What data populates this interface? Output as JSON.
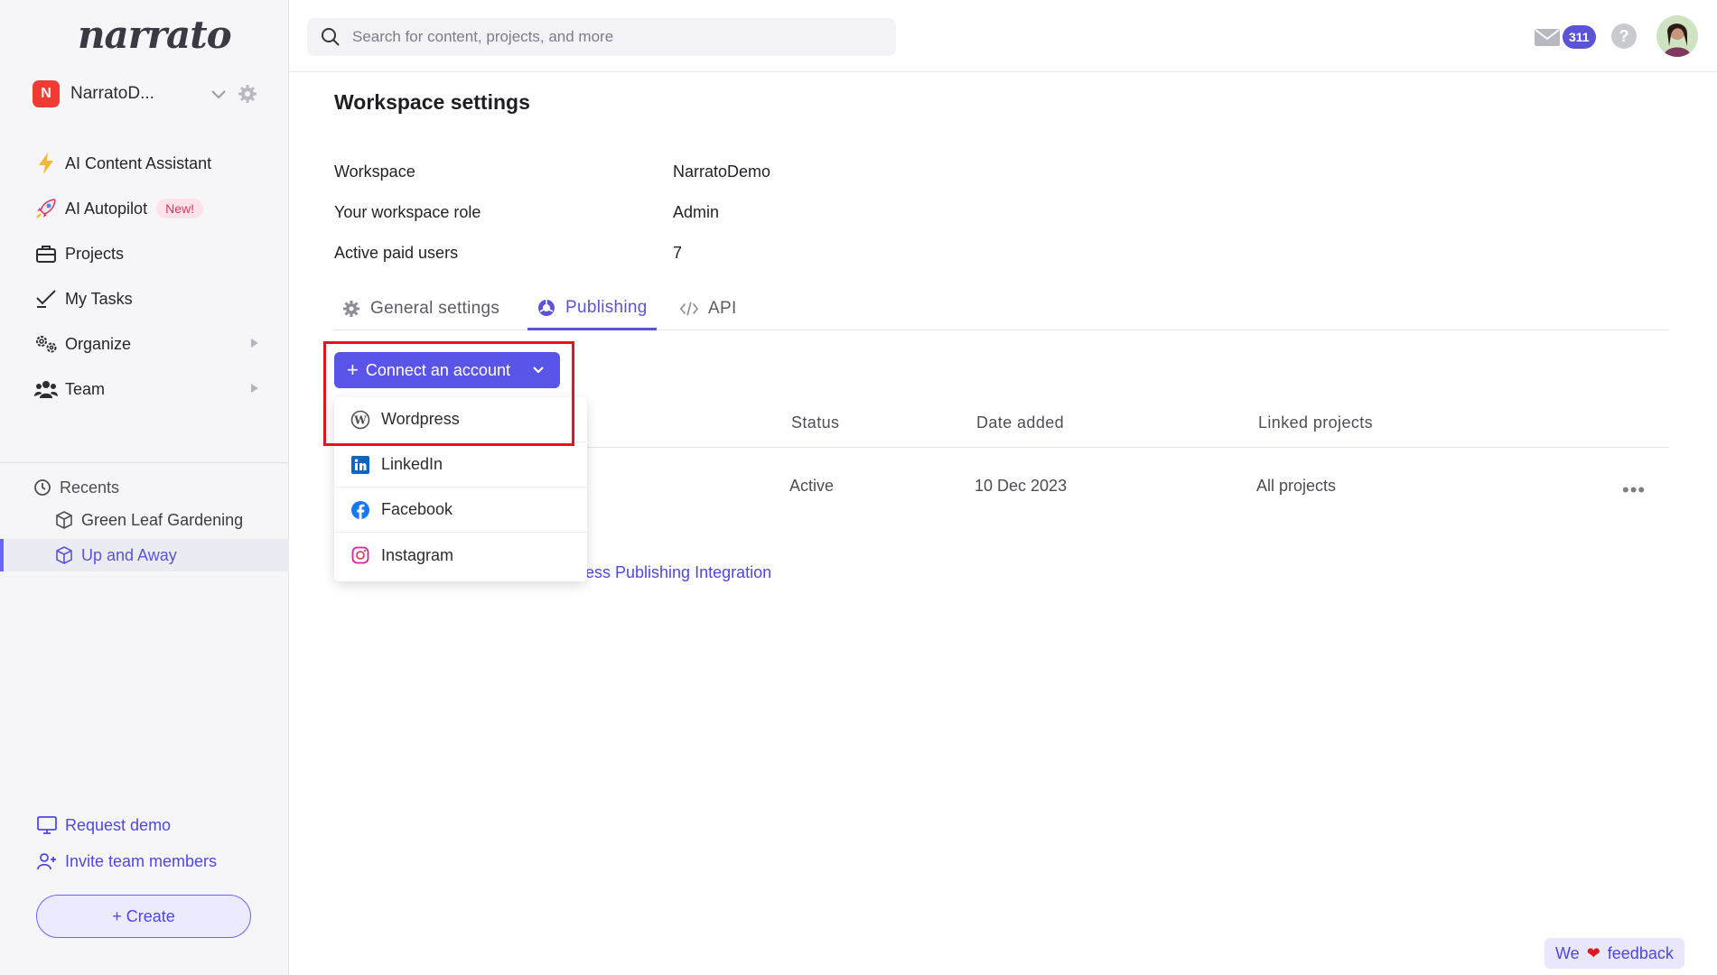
{
  "app": {
    "logo_text": "narrato"
  },
  "workspace_switcher": {
    "avatar_letter": "N",
    "name": "NarratoD..."
  },
  "sidebar": {
    "items": [
      {
        "label": "AI Content Assistant",
        "icon": "lightning-icon"
      },
      {
        "label": "AI Autopilot",
        "icon": "rocket-icon",
        "badge": "New!"
      },
      {
        "label": "Projects",
        "icon": "briefcase-icon"
      },
      {
        "label": "My Tasks",
        "icon": "checkmark-icon"
      },
      {
        "label": "Organize",
        "icon": "gears-icon",
        "has_submenu": true
      },
      {
        "label": "Team",
        "icon": "team-icon",
        "has_submenu": true
      }
    ],
    "recents_label": "Recents",
    "recents": [
      {
        "label": "Green Leaf Gardening",
        "active": false
      },
      {
        "label": "Up and Away",
        "active": true
      }
    ],
    "request_demo": "Request demo",
    "invite": "Invite team members",
    "create": "+ Create"
  },
  "search": {
    "placeholder": "Search for content, projects, and more"
  },
  "topbar": {
    "mail_count": "311",
    "help_label": "?"
  },
  "page": {
    "title": "Workspace settings",
    "info": [
      {
        "key": "Workspace",
        "value": "NarratoDemo"
      },
      {
        "key": "Your workspace role",
        "value": "Admin"
      },
      {
        "key": "Active paid users",
        "value": "7"
      }
    ],
    "tabs": [
      {
        "label": "General settings",
        "active": false
      },
      {
        "label": "Publishing",
        "active": true
      },
      {
        "label": "API",
        "active": false
      }
    ],
    "table": {
      "headers": [
        "Status",
        "Date added",
        "Linked projects"
      ],
      "rows": [
        {
          "status": "Active",
          "date": "10 Dec 2023",
          "projects": "All projects"
        }
      ]
    },
    "help_link": "ess Publishing Integration"
  },
  "connect": {
    "button_label": "Connect an account",
    "options": [
      "Wordpress",
      "LinkedIn",
      "Facebook",
      "Instagram"
    ]
  },
  "feedback": {
    "pre": "We",
    "post": "feedback"
  },
  "colors": {
    "accent": "#5b54e8",
    "highlight": "#e0161d",
    "badge_new_bg": "#fde2ea"
  }
}
